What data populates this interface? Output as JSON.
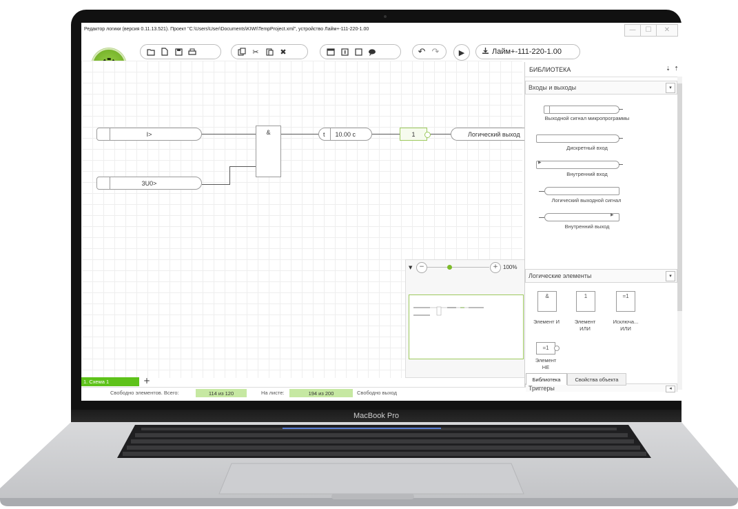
{
  "device_label": "MacBook Pro",
  "window": {
    "title": "Редактор логики (версия 0.11.13.521). Проект \"C:\\Users\\User\\Documents\\KIWI\\TempProject.xml\", устройство Лайм+-111-220-1.00",
    "min": "—",
    "max": "☐",
    "close": "✕"
  },
  "toolbar": {
    "device_button": "Лайм+-111-220-1.00",
    "icons": [
      "open-folder-icon",
      "new-file-icon",
      "save-icon",
      "print-icon",
      "copy-icon",
      "cut-icon",
      "paste-icon",
      "delete-icon",
      "window-icon",
      "info-icon",
      "square-icon",
      "comment-icon",
      "undo-icon",
      "redo-icon",
      "play-icon",
      "download-icon"
    ]
  },
  "canvas": {
    "input1": "I>",
    "input2": "3U0>",
    "and_gate": "&",
    "timer_t": "t",
    "timer_value": "10.00 с",
    "or_gate": "1",
    "output": "Логический выход"
  },
  "zoom": {
    "percent": "100%",
    "level": 0.35
  },
  "library": {
    "title": "БИБЛИОТЕКА",
    "section_io": "Входы и выходы",
    "io_items": [
      "Выходной сигнал микропрограммы",
      "Дискретный вход",
      "Внутренний вход",
      "Логический выходной сигнал",
      "Внутренний выход"
    ],
    "section_logic": "Логические элементы",
    "logic_items": [
      {
        "symbol": "&",
        "label": "Элемент И"
      },
      {
        "symbol": "1",
        "label": "Элемент ИЛИ"
      },
      {
        "symbol": "=1",
        "label": "Исключа... ИЛИ"
      },
      {
        "symbol": "=1",
        "label": "Элемент НЕ"
      }
    ],
    "section_triggers": "Триггеры",
    "tab_library": "Библиотека",
    "tab_properties": "Свойства объекта"
  },
  "sheets": {
    "tab": "1. Схема 1",
    "add": "+"
  },
  "status": {
    "free_total_label": "Свободно элементов. Всего:",
    "free_total_value": "114 из 120",
    "on_sheet_label": "На листе:",
    "on_sheet_value": "194 из 200",
    "free_output": "Свободно выход"
  },
  "colors": {
    "accent_green": "#7dbb2a",
    "sheet_tab_green": "#5ec21a",
    "status_green": "#c6e8a2"
  }
}
